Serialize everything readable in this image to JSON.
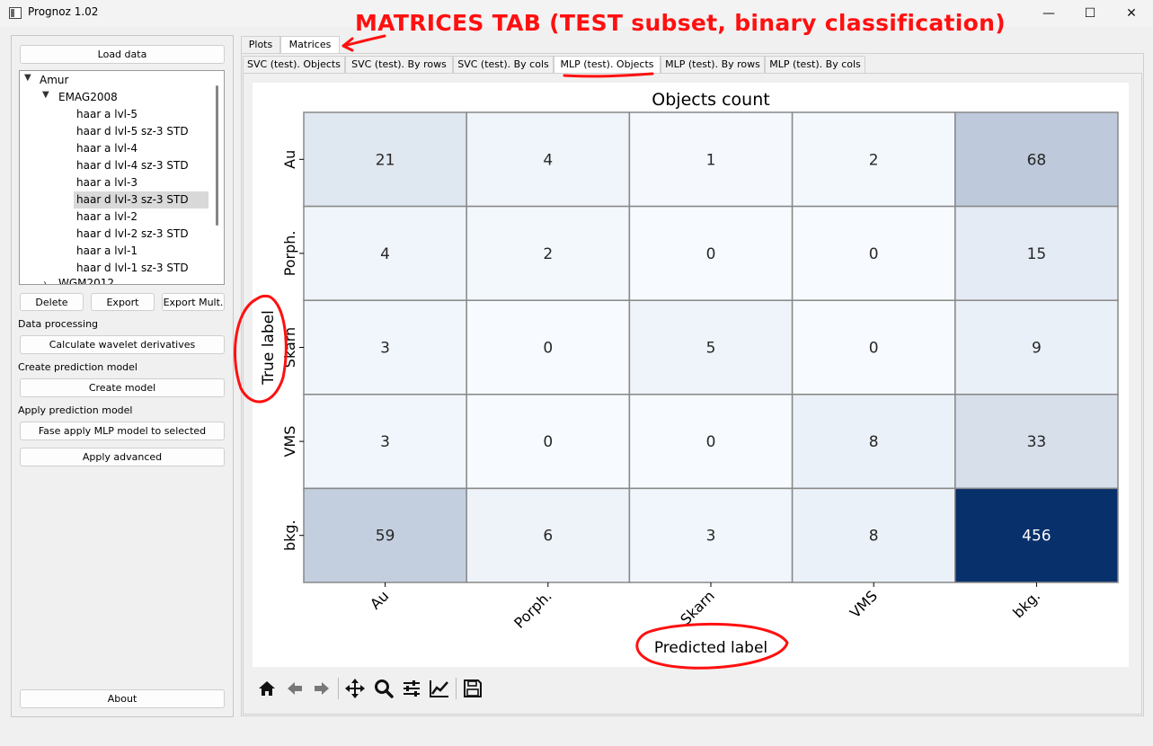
{
  "window": {
    "title": "Prognoz 1.02",
    "controls": {
      "minimize": "—",
      "maximize": "☐",
      "close": "✕"
    }
  },
  "annotations": {
    "headline": "MATRICES TAB (TEST subset, binary classification)",
    "color": "#ff1010"
  },
  "sidebar": {
    "load_data": "Load data",
    "tree": [
      {
        "label": "Amur",
        "expanded": true
      },
      {
        "label": "EMAG2008",
        "expanded": true
      },
      {
        "label": "haar a lvl-5"
      },
      {
        "label": "haar d lvl-5 sz-3 STD"
      },
      {
        "label": "haar a lvl-4"
      },
      {
        "label": "haar d lvl-4 sz-3 STD"
      },
      {
        "label": "haar a lvl-3"
      },
      {
        "label": "haar d lvl-3 sz-3 STD",
        "selected": true
      },
      {
        "label": "haar a lvl-2"
      },
      {
        "label": "haar d lvl-2 sz-3 STD"
      },
      {
        "label": "haar a lvl-1"
      },
      {
        "label": "haar d lvl-1 sz-3 STD"
      },
      {
        "label": "WGM2012",
        "expanded": false
      }
    ],
    "buttons": {
      "delete": "Delete",
      "export": "Export",
      "export_mult": "Export Mult."
    },
    "data_processing_label": "Data processing",
    "calc_wavelet": "Calculate wavelet derivatives",
    "create_model_label": "Create prediction model",
    "create_model": "Create model",
    "apply_model_label": "Apply prediction model",
    "fast_apply": "Fase apply MLP model to selected",
    "apply_advanced": "Apply advanced",
    "about": "About"
  },
  "main_tabs": [
    "Plots",
    "Matrices"
  ],
  "active_main_tab": "Matrices",
  "sub_tabs": [
    "SVC (test). Objects",
    "SVC (test). By rows",
    "SVC (test). By cols",
    "MLP (test). Objects",
    "MLP (test). By rows",
    "MLP (test). By cols"
  ],
  "active_sub_tab": "MLP (test). Objects",
  "chart_data": {
    "type": "heatmap",
    "title": "Objects count",
    "xlabel": "Predicted label",
    "ylabel": "True label",
    "x_categories": [
      "Au",
      "Porph.",
      "Skarn",
      "VMS",
      "bkg."
    ],
    "y_categories": [
      "Au",
      "Porph.",
      "Skarn",
      "VMS",
      "bkg."
    ],
    "values": [
      [
        21,
        4,
        1,
        2,
        68
      ],
      [
        4,
        2,
        0,
        0,
        15
      ],
      [
        3,
        0,
        5,
        0,
        9
      ],
      [
        3,
        0,
        0,
        8,
        33
      ],
      [
        59,
        6,
        3,
        8,
        456
      ]
    ],
    "colormap": "Blues",
    "vmin": 0,
    "vmax": 456
  },
  "toolbar_icons": [
    "home-icon",
    "back-arrow-icon",
    "forward-arrow-icon",
    "pan-icon",
    "zoom-icon",
    "configure-subplots-icon",
    "edit-axis-icon",
    "save-icon"
  ]
}
